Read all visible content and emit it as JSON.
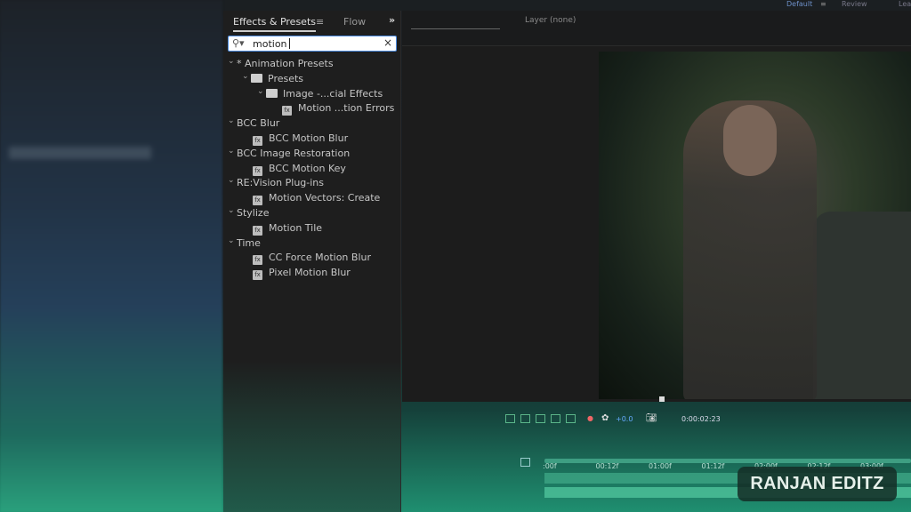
{
  "workspace": {
    "items": [
      "Default",
      "Review",
      "Lea"
    ],
    "menu_icon": "hamburger-icon"
  },
  "effects_panel": {
    "tab_active": "Effects & Presets",
    "tab_other": "Flow",
    "more": "»",
    "search": {
      "value": "motion",
      "clear": "×"
    },
    "tree": [
      {
        "label": "* Animation Presets",
        "type": "category",
        "level": 0
      },
      {
        "label": "Presets",
        "type": "folder",
        "level": 1
      },
      {
        "label": "Image -...cial Effects",
        "type": "folder",
        "level": 2
      },
      {
        "label": "Motion ...tion Errors",
        "type": "preset",
        "level": 3
      },
      {
        "label": "BCC Blur",
        "type": "category",
        "level": 0
      },
      {
        "label": "BCC Motion Blur",
        "type": "effect",
        "level": 1
      },
      {
        "label": "BCC Image Restoration",
        "type": "category",
        "level": 0
      },
      {
        "label": "BCC Motion Key",
        "type": "effect",
        "level": 1
      },
      {
        "label": "RE:Vision Plug-ins",
        "type": "category",
        "level": 0
      },
      {
        "label": "Motion Vectors: Create",
        "type": "effect",
        "level": 1
      },
      {
        "label": "Stylize",
        "type": "category",
        "level": 0
      },
      {
        "label": "Motion Tile",
        "type": "effect",
        "level": 1
      },
      {
        "label": "Time",
        "type": "category",
        "level": 0
      },
      {
        "label": "CC Force Motion Blur",
        "type": "effect",
        "level": 1
      },
      {
        "label": "Pixel Motion Blur",
        "type": "effect",
        "level": 1
      }
    ]
  },
  "composition": {
    "layer_label": "Layer (none)",
    "exposure": "+0.0",
    "timecode": "0:00:02:23"
  },
  "timeline": {
    "ticks": [
      ":00f",
      "00:12f",
      "01:00f",
      "01:12f",
      "02:00f",
      "02:12f",
      "03:00f"
    ]
  },
  "watermark": "RANJAN EDITZ"
}
